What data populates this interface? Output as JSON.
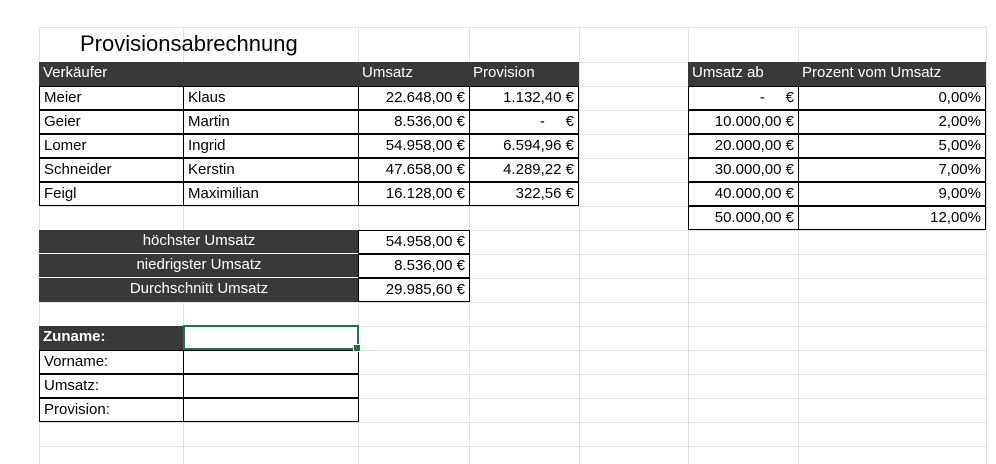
{
  "title": "Provisionsabrechnung",
  "sales_table": {
    "headers": [
      "Verkäufer",
      "",
      "Umsatz",
      "Provision"
    ],
    "rows": [
      {
        "last": "Meier",
        "first": "Klaus",
        "umsatz": "22.648,00 €",
        "provision": "1.132,40 €"
      },
      {
        "last": "Geier",
        "first": "Martin",
        "umsatz": "8.536,00 €",
        "provision": "-     €"
      },
      {
        "last": "Lomer",
        "first": "Ingrid",
        "umsatz": "54.958,00 €",
        "provision": "6.594,96 €"
      },
      {
        "last": "Schneider",
        "first": "Kerstin",
        "umsatz": "47.658,00 €",
        "provision": "4.289,22 €"
      },
      {
        "last": "Feigl",
        "first": "Maximilian",
        "umsatz": "16.128,00 €",
        "provision": "322,56 €"
      }
    ]
  },
  "rate_table": {
    "headers": [
      "Umsatz ab",
      "Prozent vom Umsatz"
    ],
    "rows": [
      {
        "from": "-     €",
        "percent": "0,00%"
      },
      {
        "from": "10.000,00 €",
        "percent": "2,00%"
      },
      {
        "from": "20.000,00 €",
        "percent": "5,00%"
      },
      {
        "from": "30.000,00 €",
        "percent": "7,00%"
      },
      {
        "from": "40.000,00 €",
        "percent": "9,00%"
      },
      {
        "from": "50.000,00 €",
        "percent": "12,00%"
      }
    ]
  },
  "stats": [
    {
      "label": "höchster Umsatz",
      "value": "54.958,00 €"
    },
    {
      "label": "niedrigster Umsatz",
      "value": "8.536,00 €"
    },
    {
      "label": "Durchschnitt Umsatz",
      "value": "29.985,60 €"
    }
  ],
  "lookup": [
    {
      "label": "Zuname:",
      "value": ""
    },
    {
      "label": "Vorname:",
      "value": ""
    },
    {
      "label": "Umsatz:",
      "value": ""
    },
    {
      "label": "Provision:",
      "value": ""
    }
  ],
  "colors": {
    "header_dark": "#3b3838",
    "selection": "#217346",
    "gridline": "#e1e1e1"
  }
}
